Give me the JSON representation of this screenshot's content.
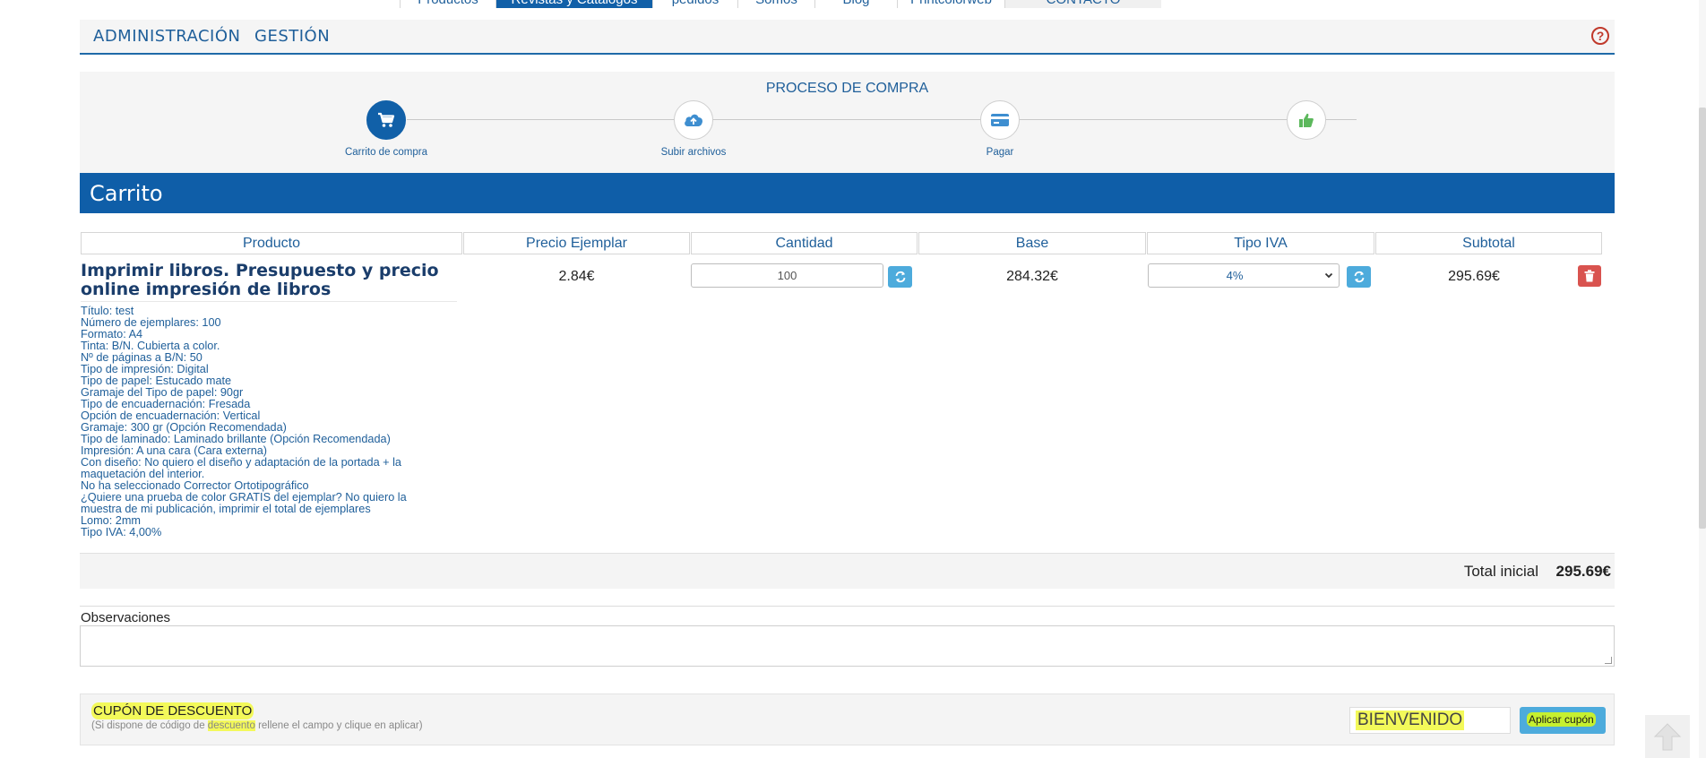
{
  "top_nav": [
    {
      "label": "Productos",
      "w": 107,
      "active": false,
      "gray": false
    },
    {
      "label": "Revistas y Catálogos",
      "w": 175,
      "active": true,
      "gray": false
    },
    {
      "label": "pedidos",
      "w": 95,
      "active": false,
      "gray": false
    },
    {
      "label": "Somos",
      "w": 86,
      "active": false,
      "gray": false
    },
    {
      "label": "Blog",
      "w": 92,
      "active": false,
      "gray": false
    },
    {
      "label": "Printcolorweb",
      "w": 120,
      "active": false,
      "gray": false
    },
    {
      "label": "CONTACTO",
      "w": 175,
      "active": false,
      "gray": true
    }
  ],
  "admin_bar": {
    "admin_label": "ADMINISTRACIÓN",
    "gestion_label": "GESTIÓN",
    "help_label": "?"
  },
  "process": {
    "title": "PROCESO DE COMPRA",
    "steps": [
      {
        "label": "Carrito de compra",
        "icon": "cart-icon",
        "active": true
      },
      {
        "label": "Subir archivos",
        "icon": "cloud-upload-icon",
        "active": false
      },
      {
        "label": "Pagar",
        "icon": "credit-card-icon",
        "active": false
      },
      {
        "label": "",
        "icon": "thumbs-up-icon",
        "active": false
      }
    ]
  },
  "cart": {
    "title": "Carrito",
    "headers": [
      "Producto",
      "Precio Ejemplar",
      "Cantidad",
      "Base",
      "Tipo IVA",
      "Subtotal"
    ],
    "item": {
      "name": "Imprimir libros. Presupuesto y precio online impresión de libros",
      "details": [
        "Título: test",
        "Número de ejemplares: 100",
        "Formato: A4",
        "Tinta: B/N. Cubierta a color.",
        "Nº de páginas a B/N: 50",
        "Tipo de impresión: Digital",
        "Tipo de papel: Estucado mate",
        "Gramaje del Tipo de papel: 90gr",
        "Tipo de encuadernación: Fresada",
        "Opción de encuadernación: Vertical",
        "Gramaje: 300 gr (Opción Recomendada)",
        "Tipo de laminado: Laminado brillante (Opción Recomendada)",
        "Impresión: A una cara (Cara externa)",
        "Con diseño: No quiero el diseño y adaptación de la portada + la maquetación del interior.",
        "No ha seleccionado Corrector Ortotipográfico",
        "¿Quiere una prueba de color GRATIS del ejemplar? No quiero la muestra de mi publicación, imprimir el total de ejemplares",
        "Lomo: 2mm",
        "Tipo IVA: 4,00%"
      ],
      "price": "2.84€",
      "quantity": "100",
      "base": "284.32€",
      "iva": "4%",
      "subtotal": "295.69€"
    },
    "total_label": "Total inicial",
    "total_value": "295.69€"
  },
  "observaciones_label": "Observaciones",
  "coupon": {
    "title": "CUPÓN DE DESCUENTO",
    "subtitle_pre": "(Si dispone de código de ",
    "subtitle_hl": "descuento",
    "subtitle_post": " rellene el campo y clique en aplicar)",
    "code_value": "BIENVENIDO",
    "apply_label": "Aplicar cupón"
  }
}
